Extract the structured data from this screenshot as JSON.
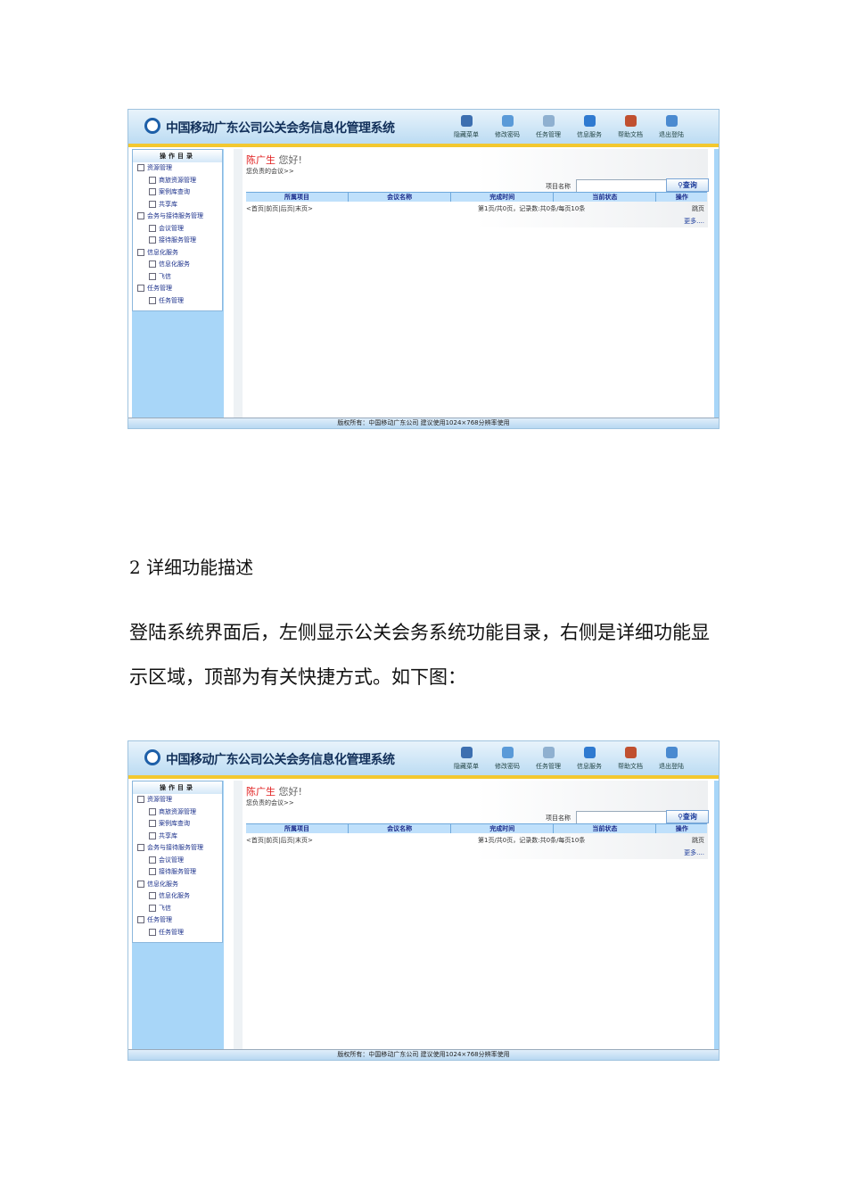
{
  "screenshot": {
    "title": "中国移动广东公司公关会务信息化管理系统",
    "toolbar": [
      {
        "label": "隐藏菜单",
        "color": "#3d6fb0"
      },
      {
        "label": "修改密码",
        "color": "#5a9ad8"
      },
      {
        "label": "任务管理",
        "color": "#8fb0d0"
      },
      {
        "label": "信息服务",
        "color": "#2f7ad0"
      },
      {
        "label": "帮助文档",
        "color": "#c05030"
      },
      {
        "label": "退出登陆",
        "color": "#4a8ad0"
      }
    ],
    "menu_title": "操作目录",
    "menu": [
      {
        "label": "资源管理",
        "level": 1
      },
      {
        "label": "商旅资源管理",
        "level": 2
      },
      {
        "label": "案例库查询",
        "level": 2
      },
      {
        "label": "共享库",
        "level": 2
      },
      {
        "label": "会务与接待服务管理",
        "level": 1
      },
      {
        "label": "会议管理",
        "level": 2
      },
      {
        "label": "接待服务管理",
        "level": 2
      },
      {
        "label": "信息化服务",
        "level": 1
      },
      {
        "label": "信息化服务",
        "level": 2
      },
      {
        "label": "飞信",
        "level": 2
      },
      {
        "label": "任务管理",
        "level": 1
      },
      {
        "label": "任务管理",
        "level": 2
      }
    ],
    "greeting_name": "陈广生",
    "greeting": " 您好!",
    "responsible": "您负责的会议>>",
    "search_label": "项目名称",
    "search_value": "",
    "search_button": "查询",
    "columns": [
      "所属项目",
      "会议名称",
      "完成时间",
      "当前状态",
      "操作"
    ],
    "pager": "<首页|前页|后页|末页>",
    "page_info": "第1页/共0页，记录数:共0条/每页10条",
    "jump": "跳页",
    "more": "更多....",
    "footer": "版权所有：中国移动广东公司  建议使用1024×768分辨率使用"
  },
  "section_heading": "2 详细功能描述",
  "paragraph": "登陆系统界面后，左侧显示公关会务系统功能目录，右侧是详细功能显示区域，顶部为有关快捷方式。如下图："
}
